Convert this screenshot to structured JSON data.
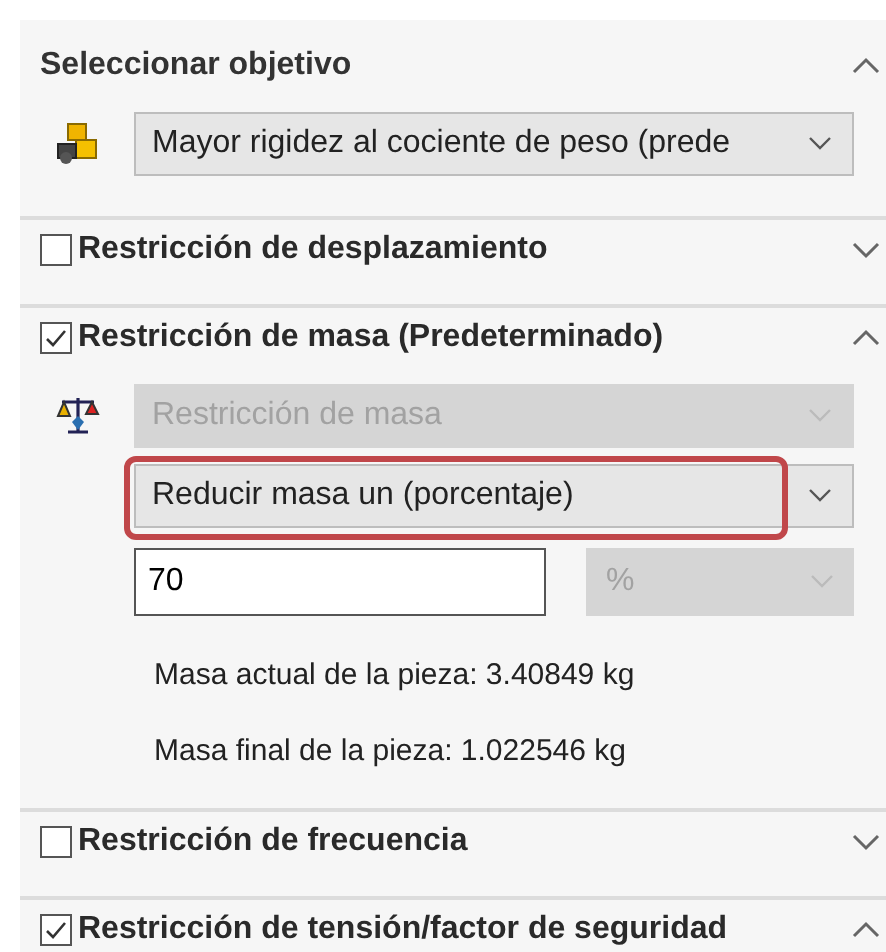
{
  "sections": [
    {
      "kind": "plain",
      "title": "Seleccionar objetivo",
      "expanded": true,
      "dropdowns": [
        {
          "value": "Mayor rigidez al cociente de peso (prede",
          "disabled": false,
          "highlighted": false
        }
      ]
    },
    {
      "kind": "check",
      "title": "Restricción de desplazamiento",
      "checked": false,
      "expanded": false
    },
    {
      "kind": "check",
      "title": "Restricción de masa (Predeterminado)",
      "checked": true,
      "expanded": true,
      "dropdowns": [
        {
          "value": "Restricción de masa",
          "disabled": true,
          "highlighted": false
        },
        {
          "value": "Reducir masa un (porcentaje)",
          "disabled": false,
          "highlighted": true
        }
      ],
      "amount": {
        "value": "70",
        "unit": "%",
        "unit_disabled": true
      },
      "notes": [
        "Masa actual de la pieza: 3.40849 kg",
        "Masa final de la pieza: 1.022546 kg"
      ]
    },
    {
      "kind": "check",
      "title": "Restricción de frecuencia",
      "checked": false,
      "expanded": false
    },
    {
      "kind": "check",
      "title": "Restricción de tensión/factor de seguridad",
      "checked": true,
      "expanded": true
    }
  ]
}
